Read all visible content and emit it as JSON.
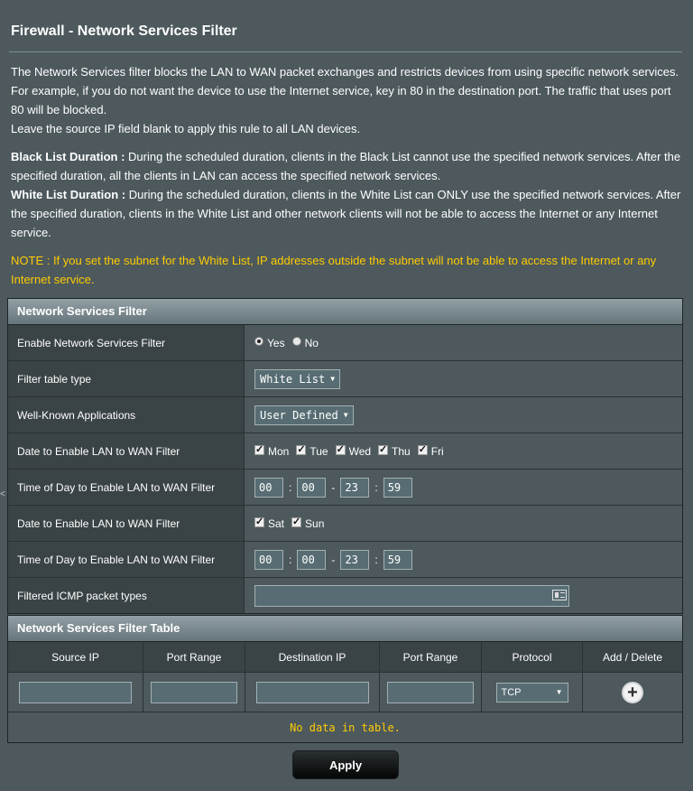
{
  "page": {
    "title": "Firewall - Network Services Filter",
    "desc_line1": "The Network Services filter blocks the LAN to WAN packet exchanges and restricts devices from using specific network services.",
    "desc_line2": "For example, if you do not want the device to use the Internet service, key in 80 in the destination port. The traffic that uses port",
    "desc_line3": "80 will be blocked.",
    "desc_line4": "Leave the source IP field blank to apply this rule to all LAN devices.",
    "black_label": "Black List Duration :",
    "black_line1": " During the scheduled duration, clients in the Black List cannot use the specified network services. After the",
    "black_line2": "specified duration, all the clients in LAN can access the specified network services.",
    "white_label": "White List Duration :",
    "white_line1": " During the scheduled duration, clients in the White List can ONLY use the specified network services. After",
    "white_line2": "the specified duration, clients in the White List and other network clients will not be able to access the Internet or any Internet",
    "white_line3": "service.",
    "note_line1": "NOTE : If you set the subnet for the White List, IP addresses outside the subnet will not be able to access the Internet or any",
    "note_line2": "Internet service.",
    "left_mark": "<"
  },
  "filter": {
    "header": "Network Services Filter",
    "enable_label": "Enable Network Services Filter",
    "enable_yes": "Yes",
    "enable_no": "No",
    "enable_selected": "Yes",
    "table_type_label": "Filter table type",
    "table_type_value": "White List",
    "apps_label": "Well-Known Applications",
    "apps_value": "User Defined",
    "weekday_date_label": "Date to Enable LAN to WAN Filter",
    "weekdays": [
      "Mon",
      "Tue",
      "Wed",
      "Thu",
      "Fri"
    ],
    "weekday_time_label": "Time of Day to Enable LAN to WAN Filter",
    "weekday_time": {
      "start_h": "00",
      "start_m": "00",
      "end_h": "23",
      "end_m": "59"
    },
    "weekend_date_label": "Date to Enable LAN to WAN Filter",
    "weekend": [
      "Sat",
      "Sun"
    ],
    "weekend_time_label": "Time of Day to Enable LAN to WAN Filter",
    "weekend_time": {
      "start_h": "00",
      "start_m": "00",
      "end_h": "23",
      "end_m": "59"
    },
    "icmp_label": "Filtered ICMP packet types",
    "icmp_value": ""
  },
  "table": {
    "header": "Network Services Filter Table",
    "columns": [
      "Source IP",
      "Port Range",
      "Destination IP",
      "Port Range",
      "Protocol",
      "Add / Delete"
    ],
    "protocol_value": "TCP",
    "empty_text": "No data in table."
  },
  "apply_label": "Apply"
}
